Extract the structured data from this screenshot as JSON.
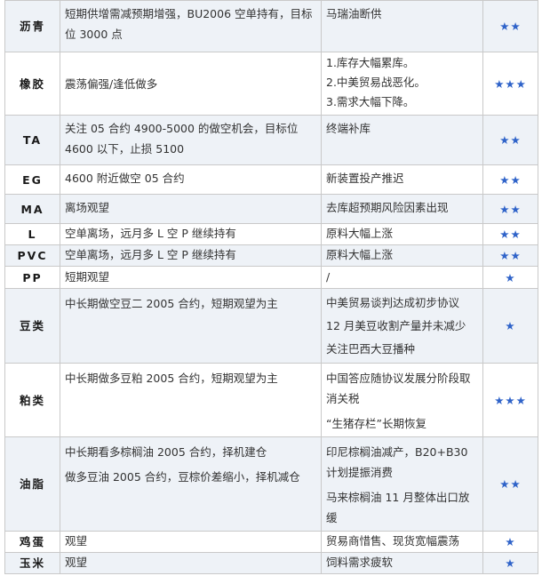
{
  "rows": [
    {
      "name": "沥青",
      "strategy": [
        "短期供增需减预期增强，BU2006 空单持有，目标位 3000 点"
      ],
      "driver": [
        "马瑞油断供"
      ],
      "rating": "★★"
    },
    {
      "name": "橡胶",
      "strategy": [
        "震荡偏强/逢低做多"
      ],
      "driver": [
        "1.库存大幅累库。",
        "2.中美贸易战恶化。",
        "3.需求大幅下降。"
      ],
      "rating": "★★★"
    },
    {
      "name": "TA",
      "strategy": [
        "关注 05 合约 4900-5000 的做空机会，目标位 4600 以下，止损 5100"
      ],
      "driver": [
        "终端补库"
      ],
      "rating": "★★"
    },
    {
      "name": "EG",
      "strategy": [
        "4600 附近做空 05 合约"
      ],
      "driver": [
        "新装置投产推迟"
      ],
      "rating": "★★"
    },
    {
      "name": "MA",
      "strategy": [
        "离场观望"
      ],
      "driver": [
        "去库超预期风险因素出现"
      ],
      "rating": "★★"
    },
    {
      "name": "L",
      "strategy": [
        "空单离场，远月多 L 空 P 继续持有"
      ],
      "driver": [
        "原料大幅上涨"
      ],
      "rating": "★★"
    },
    {
      "name": "PVC",
      "strategy": [
        "空单离场，远月多 L 空 P 继续持有"
      ],
      "driver": [
        "原料大幅上涨"
      ],
      "rating": "★★"
    },
    {
      "name": "PP",
      "strategy": [
        "短期观望"
      ],
      "driver": [
        "/"
      ],
      "rating": "★"
    },
    {
      "name": "豆类",
      "strategy": [
        "中长期做空豆二 2005 合约，短期观望为主"
      ],
      "driver": [
        "中美贸易谈判达成初步协议",
        "12 月美豆收割产量并未减少",
        "关注巴西大豆播种"
      ],
      "rating": "★"
    },
    {
      "name": "粕类",
      "strategy": [
        "中长期做多豆粕 2005 合约，短期观望为主"
      ],
      "driver": [
        "中国答应随协议发展分阶段取消关税",
        "“生猪存栏”长期恢复"
      ],
      "rating": "★★★"
    },
    {
      "name": "油脂",
      "strategy": [
        "中长期看多棕榈油 2005 合约，择机建仓",
        "做多豆油 2005 合约，豆棕价差缩小，择机减仓"
      ],
      "driver": [
        "印尼棕榈油减产，B20+B30 计划提振消费",
        "马来棕榈油 11 月整体出口放缓"
      ],
      "rating": "★★"
    },
    {
      "name": "鸡蛋",
      "strategy": [
        "观望"
      ],
      "driver": [
        "贸易商惜售、现货宽幅震荡"
      ],
      "rating": "★"
    },
    {
      "name": "玉米",
      "strategy": [
        "观望"
      ],
      "driver": [
        "饲料需求疲软"
      ],
      "rating": "★"
    }
  ]
}
